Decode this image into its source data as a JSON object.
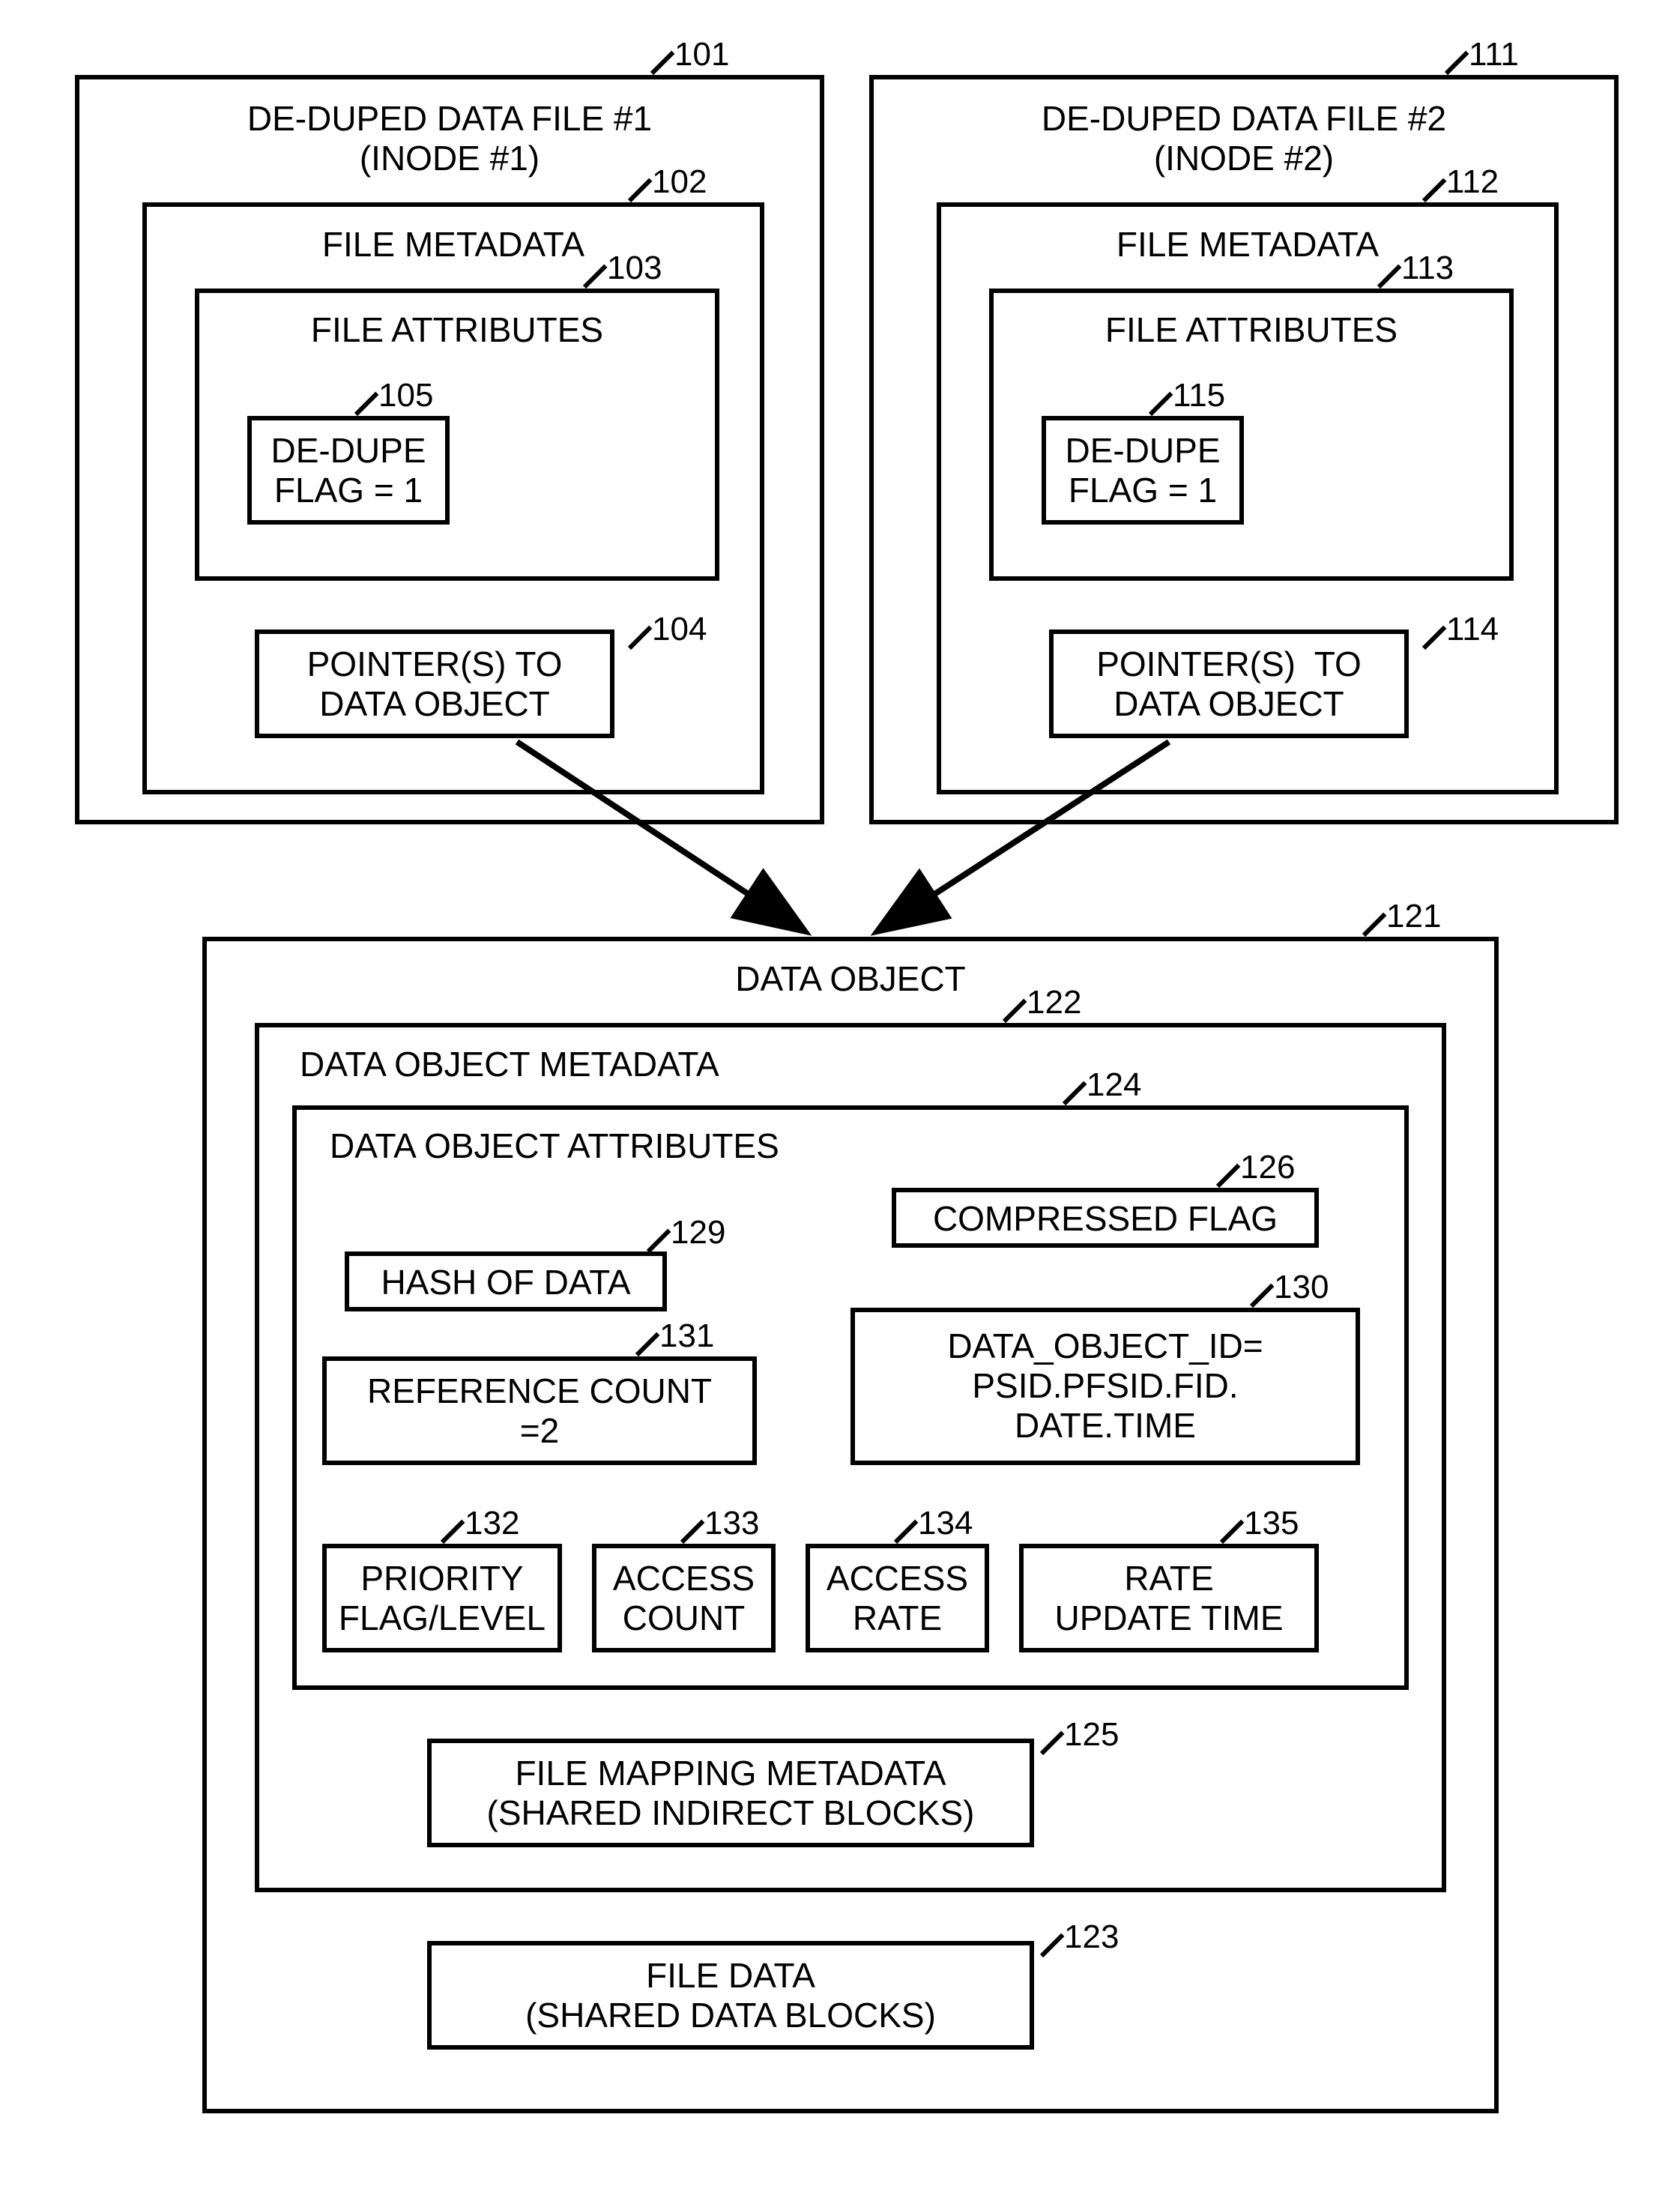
{
  "file1": {
    "ref": "101",
    "title": "DE-DUPED DATA FILE #1\n(INODE #1)",
    "metadata": {
      "ref": "102",
      "title": "FILE METADATA",
      "attributes": {
        "ref": "103",
        "title": "FILE ATTRIBUTES",
        "dedupe": {
          "ref": "105",
          "text": "DE-DUPE\nFLAG = 1"
        }
      },
      "pointer": {
        "ref": "104",
        "text": "POINTER(S) TO\nDATA OBJECT"
      }
    }
  },
  "file2": {
    "ref": "111",
    "title": "DE-DUPED DATA FILE #2\n(INODE #2)",
    "metadata": {
      "ref": "112",
      "title": "FILE METADATA",
      "attributes": {
        "ref": "113",
        "title": "FILE ATTRIBUTES",
        "dedupe": {
          "ref": "115",
          "text": "DE-DUPE\nFLAG = 1"
        }
      },
      "pointer": {
        "ref": "114",
        "text": "POINTER(S)  TO\nDATA OBJECT"
      }
    }
  },
  "dataObject": {
    "ref": "121",
    "title": "DATA OBJECT",
    "metadata": {
      "ref": "122",
      "title": "DATA OBJECT METADATA",
      "attributes": {
        "ref": "124",
        "title": "DATA OBJECT ATTRIBUTES",
        "compressed": {
          "ref": "126",
          "text": "COMPRESSED FLAG"
        },
        "hash": {
          "ref": "129",
          "text": "HASH OF DATA"
        },
        "refcount": {
          "ref": "131",
          "text": "REFERENCE COUNT\n=2"
        },
        "objectid": {
          "ref": "130",
          "text": "DATA_OBJECT_ID=\nPSID.PFSID.FID.\nDATE.TIME"
        },
        "priority": {
          "ref": "132",
          "text": "PRIORITY\nFLAG/LEVEL"
        },
        "accessCount": {
          "ref": "133",
          "text": "ACCESS\nCOUNT"
        },
        "accessRate": {
          "ref": "134",
          "text": "ACCESS\nRATE"
        },
        "rateUpdate": {
          "ref": "135",
          "text": "RATE\nUPDATE TIME"
        }
      },
      "mapping": {
        "ref": "125",
        "text": "FILE MAPPING METADATA\n(SHARED INDIRECT BLOCKS)"
      }
    },
    "fileData": {
      "ref": "123",
      "text": "FILE DATA\n(SHARED DATA BLOCKS)"
    }
  }
}
